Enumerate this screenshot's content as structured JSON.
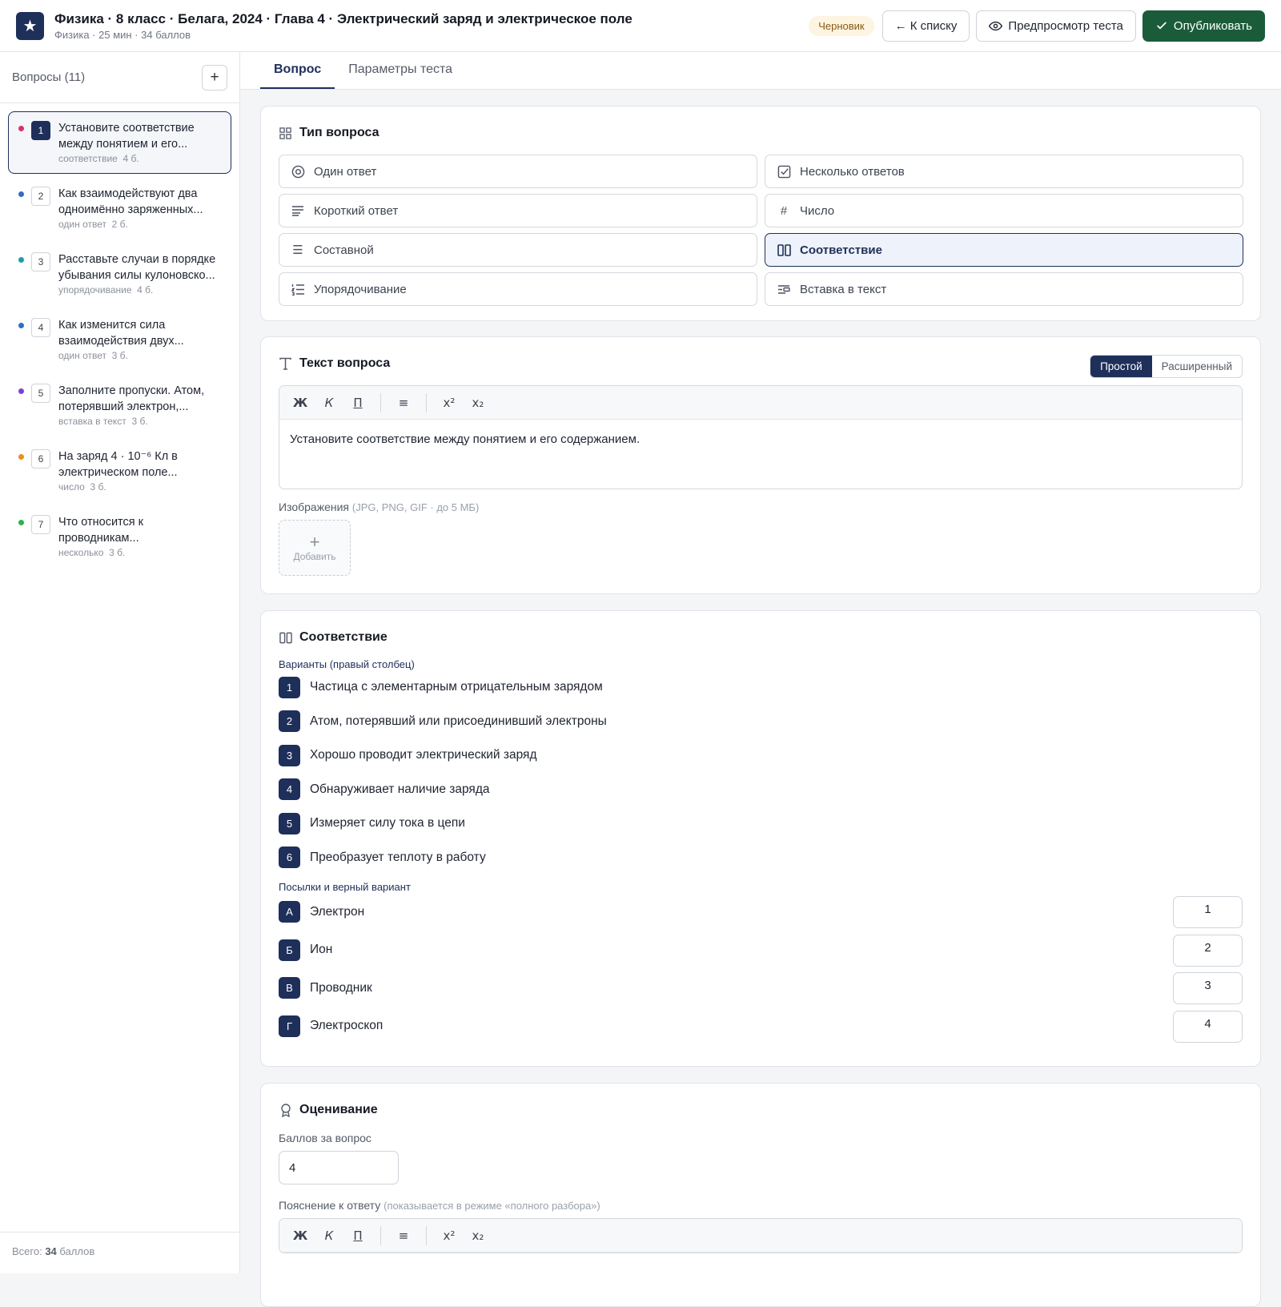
{
  "header": {
    "title": "Физика · 8 класс · Белага, 2024 · Глава 4 · Электрический заряд и электрическое поле",
    "subtitle": "Физика · 25 мин · 34 баллов",
    "status": "Черновик",
    "back_label": "← К списку",
    "preview_label": "Предпросмотр теста",
    "publish_label": "Опубликовать"
  },
  "sidebar": {
    "title": "Вопросы (11)",
    "add": "+",
    "items": [
      {
        "num": "1",
        "text": "Установите соответствие между понятием и его...",
        "type": "соответствие",
        "points": "4 б.",
        "color": "#d6336c"
      },
      {
        "num": "2",
        "text": "Как взаимодействуют два одноимённо заряженных...",
        "type": "один ответ",
        "points": "2 б.",
        "color": "#2f6fbf"
      },
      {
        "num": "3",
        "text": "Расставьте случаи в порядке убывания силы кулоновско...",
        "type": "упорядочивание",
        "points": "4 б.",
        "color": "#1c9bb0"
      },
      {
        "num": "4",
        "text": "Как изменится сила взаимодействия двух...",
        "type": "один ответ",
        "points": "3 б.",
        "color": "#2f6fbf"
      },
      {
        "num": "5",
        "text": "Заполните пропуски. Атом, потерявший электрон,...",
        "type": "вставка в текст",
        "points": "3 б.",
        "color": "#7b3fe0"
      },
      {
        "num": "6",
        "text": "На заряд 4 · 10⁻⁶ Кл в электрическом поле...",
        "type": "число",
        "points": "3 б.",
        "color": "#f08c1a"
      },
      {
        "num": "7",
        "text": "Что относится к проводникам...",
        "type": "несколько",
        "points": "3 б.",
        "color": "#2bb34a"
      }
    ],
    "footer_prefix": "Всего:",
    "footer_value": "34",
    "footer_suffix": "баллов"
  },
  "tabs": [
    "Вопрос",
    "Параметры теста"
  ],
  "question_type": {
    "title": "Тип вопроса",
    "options": [
      {
        "label": "Один ответ",
        "icon": "radio-icon"
      },
      {
        "label": "Несколько ответов",
        "icon": "checkbox-icon"
      },
      {
        "label": "Короткий ответ",
        "icon": "lines-icon"
      },
      {
        "label": "Число",
        "icon": "hash-icon"
      },
      {
        "label": "Составной",
        "icon": "list-icon"
      },
      {
        "label": "Соответствие",
        "icon": "columns-icon"
      },
      {
        "label": "Упорядочивание",
        "icon": "ordered-list-icon"
      },
      {
        "label": "Вставка в текст",
        "icon": "insert-text-icon"
      }
    ],
    "selected": "Соответствие"
  },
  "question_text": {
    "title": "Текст вопроса",
    "mode_simple": "Простой",
    "mode_advanced": "Расширенный",
    "toolbar": [
      "Ж",
      "К",
      "П",
      "≡",
      "x²",
      "x₂"
    ],
    "body": "Установите соответствие между понятием и его содержанием.",
    "images_label": "Изображения",
    "images_hint": "(JPG, PNG, GIF · до 5 МБ)",
    "add_image": "Добавить"
  },
  "matching": {
    "title": "Соответствие",
    "options_label": "Варианты (правый столбец)",
    "options": [
      {
        "num": "1",
        "text": "Частица с элементарным отрицательным зарядом"
      },
      {
        "num": "2",
        "text": "Атом, потерявший или присоединивший электроны"
      },
      {
        "num": "3",
        "text": "Хорошо проводит электрический заряд"
      },
      {
        "num": "4",
        "text": "Обнаруживает наличие заряда"
      },
      {
        "num": "5",
        "text": "Измеряет силу тока в цепи"
      },
      {
        "num": "6",
        "text": "Преобразует теплоту в работу"
      }
    ],
    "premises_label": "Посылки и верный вариант",
    "premises": [
      {
        "letter": "А",
        "text": "Электрон",
        "answer": "1"
      },
      {
        "letter": "Б",
        "text": "Ион",
        "answer": "2"
      },
      {
        "letter": "В",
        "text": "Проводник",
        "answer": "3"
      },
      {
        "letter": "Г",
        "text": "Электроскоп",
        "answer": "4"
      }
    ]
  },
  "grading": {
    "title": "Оценивание",
    "points_label": "Баллов за вопрос",
    "points_value": "4",
    "explanation_label": "Пояснение к ответу",
    "explanation_hint": "(показывается в режиме «полного разбора»)",
    "toolbar": [
      "Ж",
      "К",
      "П",
      "≡",
      "x²",
      "x₂"
    ]
  },
  "colors": {
    "brand": "#1e2f5a",
    "publish": "#1a5c3a"
  }
}
